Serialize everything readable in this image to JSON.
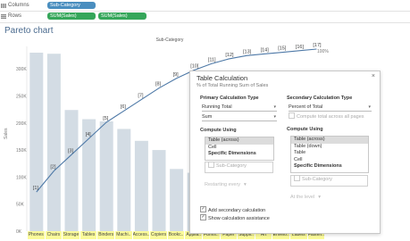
{
  "shelves": {
    "columns": {
      "label": "Columns",
      "pills": [
        "Sub-Category"
      ]
    },
    "rows": {
      "label": "Rows",
      "pills": [
        "SUM(Sales)",
        "SUM(Sales)"
      ]
    }
  },
  "view": {
    "title": "Pareto chart",
    "header": "Sub-Category",
    "right_label": "100%"
  },
  "chart_data": {
    "type": "bar",
    "title": "Pareto chart",
    "xlabel": "Sub-Category",
    "ylabel": "Sales",
    "y_ticks": [
      "0K",
      "50K",
      "100K",
      "150K",
      "200K",
      "250K",
      "300K"
    ],
    "ylim": [
      0,
      330000
    ],
    "categories": [
      "Phones",
      "Chairs",
      "Storage",
      "Tables",
      "Binders",
      "Machi..",
      "Access..",
      "Copiers",
      "Bookc..",
      "Applia..",
      "Furnis..",
      "Paper",
      "Suppli..",
      "Art",
      "Envelo..",
      "Labels",
      "Fasten.."
    ],
    "series": [
      {
        "values": [
          330000,
          328000,
          224000,
          207000,
          203000,
          189000,
          167000,
          150000,
          115000,
          108000,
          92000,
          78000,
          47000,
          27000,
          16000,
          12000,
          3000
        ]
      },
      {
        "values": [
          0.12,
          0.25,
          0.35,
          0.45,
          0.55,
          0.62,
          0.69,
          0.76,
          0.82,
          0.87,
          0.91,
          0.94,
          0.96,
          0.97,
          0.98,
          0.99,
          1.0
        ]
      }
    ],
    "point_labels": [
      "[1]",
      "[2]",
      "[3]",
      "[4]",
      "[5]",
      "[6]",
      "[7]",
      "[8]",
      "[9]",
      "[10]",
      "[11]",
      "[12]",
      "[13]",
      "[14]",
      "[15]",
      "[16]",
      "[17]"
    ],
    "bar_color": "#d3dce4",
    "line_color": "#4e79a7",
    "grid": false
  },
  "dialog": {
    "title": "Table Calculation",
    "close": "×",
    "subtitle": "% of Total Running Sum of Sales",
    "primary": {
      "heading": "Primary Calculation Type",
      "type_value": "Running Total",
      "agg_value": "Sum",
      "compute_heading": "Compute Using",
      "compute_options": [
        "Table (across)",
        "Cell",
        "Specific Dimensions"
      ],
      "dimension": "Sub-Category",
      "restart_label": "Restarting every",
      "add_secondary": "Add secondary calculation",
      "show_assistance": "Show calculation assistance"
    },
    "secondary": {
      "heading": "Secondary Calculation Type",
      "type_value": "Percent of Total",
      "total_all_pages": "Compute total across all pages",
      "compute_heading": "Compute Using",
      "compute_options": [
        "Table (across)",
        "Table (down)",
        "Table",
        "Cell",
        "Specific Dimensions"
      ],
      "dimension": "Sub-Category",
      "at_level": "At the level"
    }
  }
}
